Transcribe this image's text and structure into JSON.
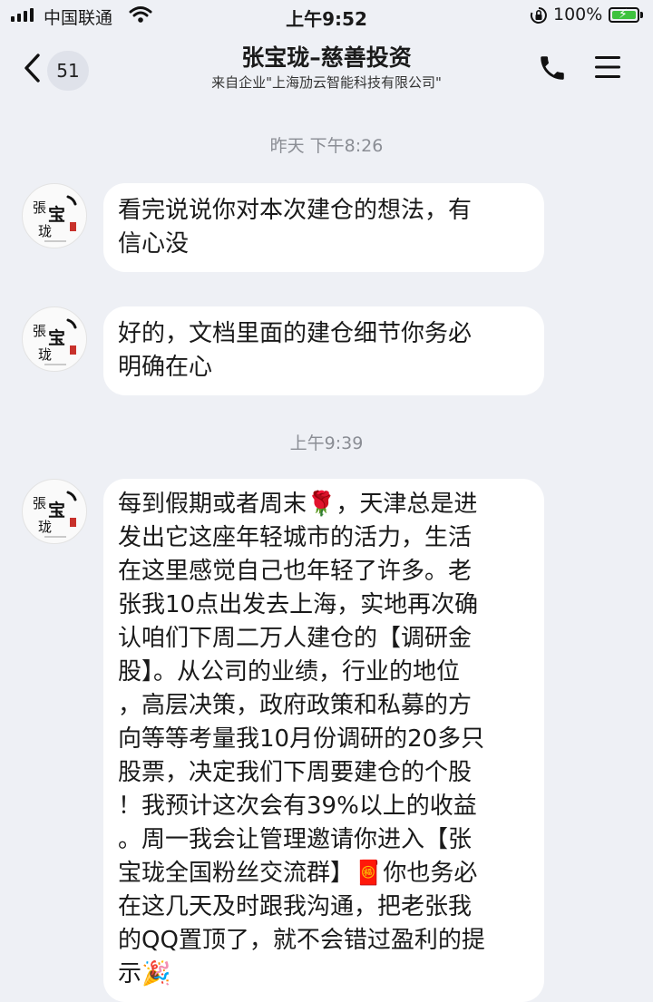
{
  "status_bar": {
    "carrier": "中国联通",
    "time": "上午9:52",
    "battery": "100%",
    "battery_level": 1.0,
    "icons": [
      "signal-bars-icon",
      "wifi-icon",
      "rotation-lock-icon",
      "battery-charging-icon"
    ]
  },
  "nav": {
    "back_icon": "chevron-left-icon",
    "unread_count": "51",
    "title": "张宝珑–慈善投资",
    "subtitle": "来自企业\"上海劢云智能科技有限公司\"",
    "call_icon": "phone-icon",
    "menu_icon": "hamburger-menu-icon"
  },
  "timestamps": [
    "昨天 下午8:26",
    "上午9:39"
  ],
  "avatar": {
    "glyphs": [
      "張",
      "宝",
      "珑"
    ]
  },
  "messages": [
    {
      "lines": [
        "看完说说你对本次建仓的想法，有",
        "信心没"
      ]
    },
    {
      "lines": [
        "好的，文档里面的建仓细节你务必",
        "明确在心"
      ]
    },
    {
      "lines": [
        "每到假期或者周末🌹，天津总是进",
        "发出它这座年轻城市的活力，生活",
        "在这里感觉自己也年轻了许多。老",
        "张我10点出发去上海，实地再次确",
        "认咱们下周二万人建仓的【调研金",
        "股】。从公司的业绩，行业的地位",
        "，高层决策，政府政策和私募的方",
        "向等等考量我10月份调研的20多只",
        "股票，决定我们下周要建仓的个股",
        "！我预计这次会有39%以上的收益",
        "。周一我会让管理邀请你进入【张",
        "宝珑全国粉丝交流群】🧧你也务必",
        "在这几天及时跟我沟通，把老张我",
        "的QQ置顶了，就不会错过盈利的提",
        "示🎉"
      ]
    }
  ]
}
